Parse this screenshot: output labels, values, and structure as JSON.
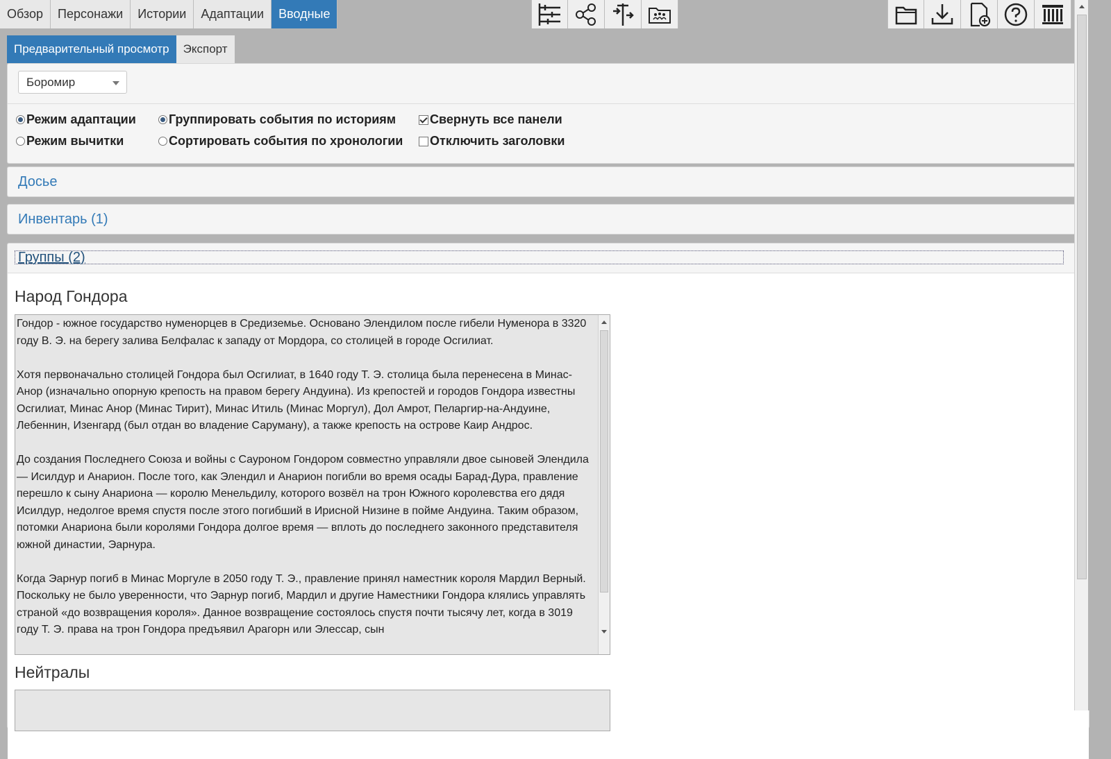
{
  "main_tabs": [
    "Обзор",
    "Персонажи",
    "Истории",
    "Адаптации",
    "Вводные"
  ],
  "active_main_tab": "Вводные",
  "toolbar_center": [
    {
      "name": "timeline-icon"
    },
    {
      "name": "network-icon"
    },
    {
      "name": "relations-icon"
    },
    {
      "name": "groups-folder-icon"
    }
  ],
  "toolbar_right": [
    {
      "name": "open-folder-icon"
    },
    {
      "name": "download-icon"
    },
    {
      "name": "new-file-icon"
    },
    {
      "name": "help-icon"
    },
    {
      "name": "columns-logo-icon"
    }
  ],
  "sub_tabs": [
    "Предварительный просмотр",
    "Экспорт"
  ],
  "active_sub_tab": "Предварительный просмотр",
  "character_select": {
    "value": "Боромир"
  },
  "options": {
    "adaptation_mode": "Режим адаптации",
    "proof_mode": "Режим вычитки",
    "group_by_story": "Группировать события по историям",
    "sort_by_time": "Сортировать события по хронологии",
    "collapse_all": "Свернуть все панели",
    "disable_headers": "Отключить заголовки"
  },
  "panels": {
    "dossier": "Досье",
    "inventory": "Инвентарь (1)",
    "groups": "Группы (2)"
  },
  "groups": [
    {
      "title": "Народ Гондора",
      "text": "Гондор - южное государство нуменорцев в Средиземье. Основано Элендилом после гибели Нуменора в 3320 году В. Э. на берегу залива Белфалас к западу от Мордора, со столицей в городе Осгилиат.\n\nХотя первоначально столицей Гондора был Осгилиат, в 1640 году Т. Э. столица была перенесена в Минас-Анор (изначально опорную крепость на правом берегу Андуина). Из крепостей и городов Гондора известны Осгилиат, Минас Анор (Минас Тирит), Минас Итиль (Минас Моргул), Дол Амрот, Пеларгир-на-Андуине, Лебеннин, Изенгард (был отдан во владение Саруману), а также крепость на острове Каир Андрос.\n\nДо создания Последнего Союза и войны с Сауроном Гондором совместно управляли двое сыновей Элендила — Исилдур и Анарион. После того, как Элендил и Анарион погибли во время осады Барад-Дура, правление перешло к сыну Анариона — королю Менельдилу, которого возвёл на трон Южного королевства его дядя Исилдур, недолгое время спустя после этого погибший в Ирисной Низине в пойме Андуина. Таким образом, потомки Анариона были королями Гондора долгое время — вплоть до последнего законного представителя южной династии, Эарнура.\n\nКогда Эарнур погиб в Минас Моргуле в 2050 году Т. Э., правление принял наместник короля Мардил Верный. Поскольку не было уверенности, что Эарнур погиб, Мардил и другие Наместники Гондора клялись управлять страной «до возвращения короля». Данное возвращение состоялось спустя почти тысячу лет, когда в 3019 году Т. Э. права на трон Гондора предъявил Арагорн или Элессар, сын"
    },
    {
      "title": "Нейтралы",
      "text": ""
    }
  ]
}
